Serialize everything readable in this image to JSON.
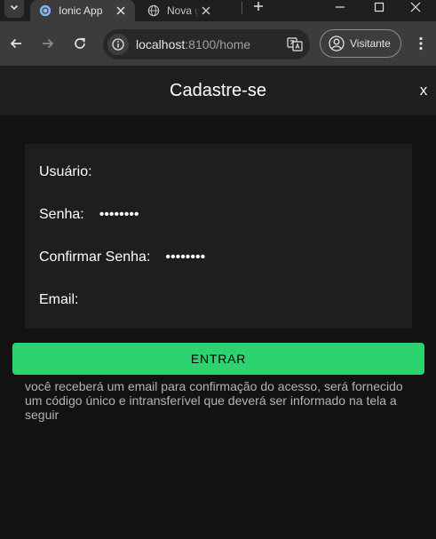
{
  "browser": {
    "tabs": [
      {
        "label": "Ionic App",
        "active": true
      },
      {
        "label": "Nova guia",
        "active": false
      }
    ],
    "url_host": "localhost",
    "url_path": ":8100/home",
    "profile_label": "Visitante",
    "accent_color": "#8ab4f8"
  },
  "app": {
    "title": "Cadastre-se",
    "close_label": "x"
  },
  "form": {
    "fields": [
      {
        "label": "Usuário:",
        "value": "",
        "type": "text"
      },
      {
        "label": "Senha:",
        "value": "12345678",
        "type": "password"
      },
      {
        "label": "Confirmar Senha:",
        "value": "12345678",
        "type": "password"
      },
      {
        "label": "Email:",
        "value": "",
        "type": "email"
      }
    ],
    "submit_label": "ENTRAR",
    "submit_color": "#2dd36f",
    "hint": "você receberá um email para confirmação do acesso, será fornecido um código único e intransferível que deverá ser informado na tela a seguir"
  }
}
